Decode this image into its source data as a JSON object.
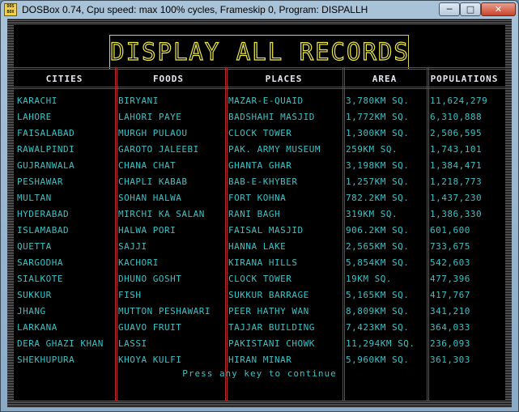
{
  "window": {
    "icon_text": "DOS BOX",
    "title": "DOSBox 0.74, Cpu speed: max 100% cycles, Frameskip  0, Program: DISPALLH",
    "minimize": "─",
    "maximize": "□",
    "close": "✕"
  },
  "screen": {
    "title": "DISPLAY ALL RECORDS",
    "headers": [
      "CITIES",
      "FOODS",
      "PLACES",
      "AREA",
      "POPULATIONS"
    ],
    "rows": [
      [
        "KARACHI",
        "BIRYANI",
        "MAZAR-E-QUAID",
        "3,780KM SQ.",
        "11,624,279"
      ],
      [
        "LAHORE",
        "LAHORI PAYE",
        "BADSHAHI MASJID",
        "1,772KM SQ.",
        "6,310,888"
      ],
      [
        "FAISALABAD",
        "MURGH PULAOU",
        "CLOCK TOWER",
        "1,300KM SQ.",
        "2,506,595"
      ],
      [
        "RAWALPINDI",
        "GAROTO JALEEBI",
        "PAK. ARMY MUSEUM",
        "259KM SQ.",
        "1,743,101"
      ],
      [
        "GUJRANWALA",
        "CHANA CHAT",
        "GHANTA GHAR",
        "3,198KM SQ.",
        "1,384,471"
      ],
      [
        "PESHAWAR",
        "CHAPLI KABAB",
        "BAB-E-KHYBER",
        "1,257KM SQ.",
        "1,218,773"
      ],
      [
        "MULTAN",
        "SOHAN HALWA",
        "FORT KOHNA",
        "782.2KM SQ.",
        "1,437,230"
      ],
      [
        "HYDERABAD",
        "MIRCHI KA SALAN",
        "RANI BAGH",
        "319KM SQ.",
        "1,386,330"
      ],
      [
        "ISLAMABAD",
        "HALWA PORI",
        "FAISAL MASJID",
        "906.2KM SQ.",
        "601,600"
      ],
      [
        "QUETTA",
        "SAJJI",
        "HANNA LAKE",
        "2,565KM SQ.",
        "733,675"
      ],
      [
        "SARGODHA",
        "KACHORI",
        "KIRANA HILLS",
        "5,854KM SQ.",
        "542,603"
      ],
      [
        "SIALKOTE",
        "DHUNO GOSHT",
        "CLOCK TOWER",
        "19KM SQ.",
        "477,396"
      ],
      [
        "SUKKUR",
        "FISH",
        "SUKKUR BARRAGE",
        "5,165KM SQ.",
        "417,767"
      ],
      [
        "JHANG",
        "MUTTON PESHAWARI",
        "PEER HATHY WAN",
        "8,809KM SQ.",
        "341,210"
      ],
      [
        "LARKANA",
        "GUAVO FRUIT",
        "TAJJAR BUILDING",
        "7,423KM SQ.",
        "364,033"
      ],
      [
        "DERA GHAZI KHAN",
        "LASSI",
        "PAKISTANI CHOWK",
        "11,294KM SQ.",
        "236,093"
      ],
      [
        "SHEKHUPURA",
        "KHOYA KULFI",
        "HIRAN MINAR",
        "5,960KM SQ.",
        "361,303"
      ]
    ],
    "prompt": "Press any key to continue",
    "colors": {
      "border_stripes": "#b63dbe",
      "title": "#ece84a",
      "grid_lines": "#b32828",
      "headers": "#e6e8f2",
      "cells": "#36c3c6",
      "background": "#000000"
    }
  }
}
